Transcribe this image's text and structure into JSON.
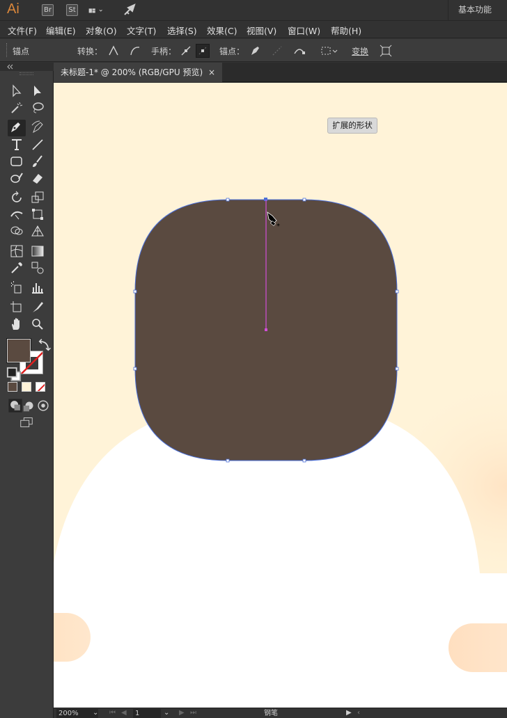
{
  "app": {
    "logo": "Ai",
    "bridge": "Br",
    "stock": "St",
    "workspace": "基本功能"
  },
  "menu": [
    "文件(F)",
    "编辑(E)",
    "对象(O)",
    "文字(T)",
    "选择(S)",
    "效果(C)",
    "视图(V)",
    "窗口(W)",
    "帮助(H)"
  ],
  "control": {
    "anchor_label": "锚点",
    "convert_label": "转换：",
    "handle_label": "手柄：",
    "anchors_label": "锚点：",
    "transform_label": "变换"
  },
  "document_tab": {
    "title": "未标题-1* @ 200% (RGB/GPU 预览)",
    "close": "×"
  },
  "canvas": {
    "tooltip": "扩展的形状",
    "background_color": "#fff3d8",
    "shape_fill": "#5a4a40",
    "path_color": "#4a6fd8",
    "handle_color": "#d14fd8"
  },
  "status": {
    "zoom": "200%",
    "page": "1",
    "tool_name": "钢笔"
  },
  "tools": {
    "fill_color": "#5a4a40"
  }
}
